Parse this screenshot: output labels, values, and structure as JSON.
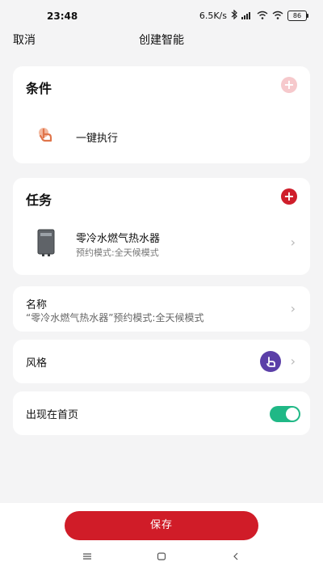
{
  "status_bar": {
    "time": "23:48",
    "network_speed": "6.5K/s",
    "battery": "86"
  },
  "nav": {
    "cancel_label": "取消",
    "title": "创建智能"
  },
  "condition": {
    "title": "条件",
    "item_label": "一键执行"
  },
  "task": {
    "title": "任务",
    "device_name": "零冷水燃气热水器",
    "device_mode": "预约模式:全天候模式"
  },
  "name_section": {
    "label": "名称",
    "value": "“零冷水燃气热水器”预约模式:全天候模式"
  },
  "style_section": {
    "label": "风格"
  },
  "homepage_section": {
    "label": "出现在首页",
    "enabled": true
  },
  "save_label": "保存",
  "colors": {
    "accent": "#d01c28",
    "toggle_on": "#20b886",
    "style_icon_bg": "#5b3fa8",
    "condition_icon": "#e0754b"
  }
}
